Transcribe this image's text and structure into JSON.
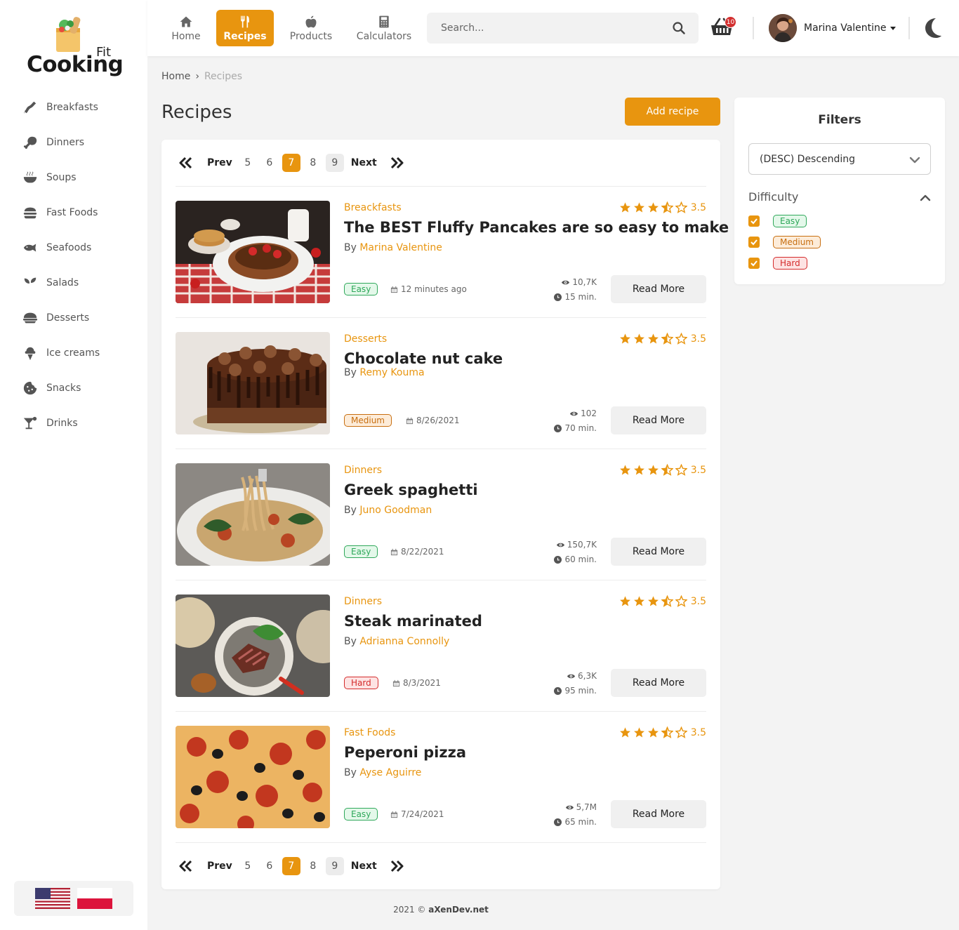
{
  "brand": {
    "fit": "Fit",
    "cooking": "Cooking"
  },
  "sidebar": {
    "items": [
      {
        "label": "Breakfasts",
        "icon": "bacon-icon"
      },
      {
        "label": "Dinners",
        "icon": "drumstick-icon"
      },
      {
        "label": "Soups",
        "icon": "soup-bowl-icon"
      },
      {
        "label": "Fast Foods",
        "icon": "burger-icon"
      },
      {
        "label": "Seafoods",
        "icon": "fish-icon"
      },
      {
        "label": "Salads",
        "icon": "seedling-icon"
      },
      {
        "label": "Desserts",
        "icon": "pie-icon"
      },
      {
        "label": "Ice creams",
        "icon": "ice-cream-icon"
      },
      {
        "label": "Snacks",
        "icon": "cookie-icon"
      },
      {
        "label": "Drinks",
        "icon": "cocktail-icon"
      }
    ],
    "languages": [
      "us-flag-icon",
      "poland-flag-icon"
    ]
  },
  "topnav": {
    "items": [
      {
        "label": "Home",
        "icon": "home-icon"
      },
      {
        "label": "Recipes",
        "icon": "utensils-icon",
        "active": true
      },
      {
        "label": "Products",
        "icon": "apple-icon"
      },
      {
        "label": "Calculators",
        "icon": "calculator-icon"
      }
    ],
    "search_placeholder": "Search...",
    "cart_count": "10",
    "user_name": "Marina Valentine"
  },
  "breadcrumb": {
    "home": "Home",
    "current": "Recipes"
  },
  "page": {
    "title": "Recipes",
    "add_button": "Add recipe"
  },
  "pagination": {
    "prev": "Prev",
    "next": "Next",
    "pages": [
      "5",
      "6",
      "7",
      "8",
      "9"
    ],
    "current": "7"
  },
  "recipes": [
    {
      "category": "Breackfasts",
      "title": "The BEST Fluffy Pancakes are so easy to make",
      "by": "By",
      "author": "Marina Valentine",
      "rating": "3.5",
      "difficulty": "Easy",
      "date": "12 minutes ago",
      "views": "10,7K",
      "time": "15 min.",
      "read_more": "Read More"
    },
    {
      "category": "Desserts",
      "title": "Chocolate nut cake",
      "by": "By",
      "author": "Remy Kouma",
      "rating": "3.5",
      "difficulty": "Medium",
      "date": "8/26/2021",
      "views": "102",
      "time": "70 min.",
      "read_more": "Read More"
    },
    {
      "category": "Dinners",
      "title": "Greek spaghetti",
      "by": "By",
      "author": "Juno Goodman",
      "rating": "3.5",
      "difficulty": "Easy",
      "date": "8/22/2021",
      "views": "150,7K",
      "time": "60 min.",
      "read_more": "Read More"
    },
    {
      "category": "Dinners",
      "title": "Steak marinated",
      "by": "By",
      "author": "Adrianna Connolly",
      "rating": "3.5",
      "difficulty": "Hard",
      "date": "8/3/2021",
      "views": "6,3K",
      "time": "95 min.",
      "read_more": "Read More"
    },
    {
      "category": "Fast Foods",
      "title": "Peperoni pizza",
      "by": "By",
      "author": "Ayse Aguirre",
      "rating": "3.5",
      "difficulty": "Easy",
      "date": "7/24/2021",
      "views": "5,7M",
      "time": "65 min.",
      "read_more": "Read More"
    }
  ],
  "filters": {
    "title": "Filters",
    "sort_value": "(DESC) Descending",
    "difficulty_label": "Difficulty",
    "options": [
      {
        "label": "Easy",
        "checked": true
      },
      {
        "label": "Medium",
        "checked": true
      },
      {
        "label": "Hard",
        "checked": true
      }
    ]
  },
  "footer": {
    "year": "2021 ©",
    "site": "aXenDev.net"
  },
  "colors": {
    "accent": "#e8950f",
    "easy": "#2fa85a",
    "medium": "#c76e10",
    "hard": "#d42b2b"
  }
}
